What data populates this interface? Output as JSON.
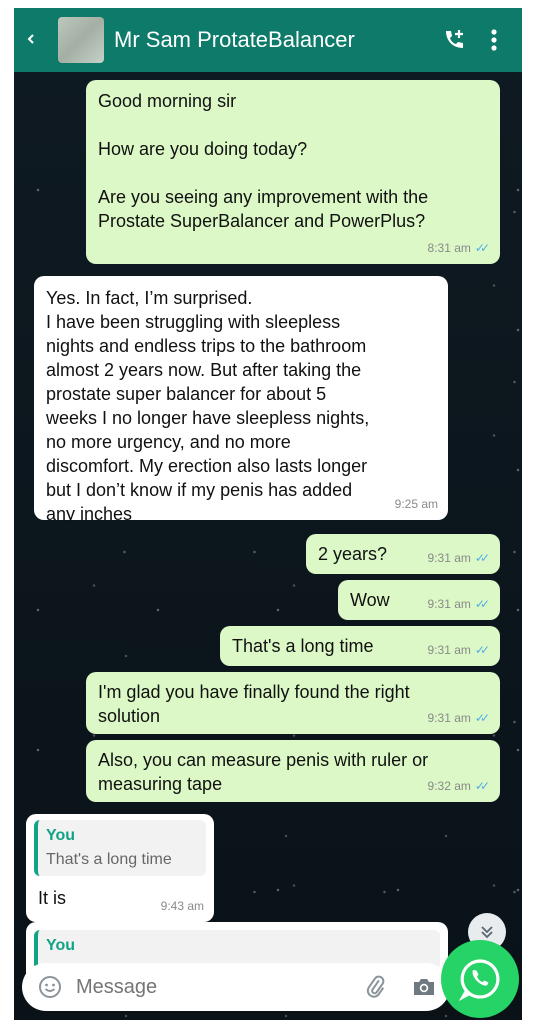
{
  "header": {
    "contact_name": "Mr Sam ProtateBalancer"
  },
  "messages": [
    {
      "dir": "out",
      "text": "Good morning sir\n\nHow are you doing today?\n\nAre you seeing any improvement with the Prostate SuperBalancer and PowerPlus?",
      "time": "8:31 am"
    },
    {
      "dir": "in",
      "text": "Yes. In fact, I’m surprised.\nI have been struggling with sleepless nights and endless trips to the bathroom almost 2 years now. But after taking the prostate super balancer for about 5 weeks I no longer have sleepless nights, no more urgency, and no more discomfort. My erection also lasts longer but I don’t know if my penis has added any inches",
      "time": "9:25 am"
    },
    {
      "dir": "out",
      "text": "2 years?",
      "time": "9:31 am"
    },
    {
      "dir": "out",
      "text": "Wow",
      "time": "9:31 am"
    },
    {
      "dir": "out",
      "text": "That's a long time",
      "time": "9:31 am"
    },
    {
      "dir": "out",
      "text": "I'm glad you have finally found the right solution",
      "time": "9:31 am"
    },
    {
      "dir": "out",
      "text": "Also, you can measure penis with ruler or measuring tape",
      "time": "9:32 am"
    },
    {
      "dir": "in",
      "quote_name": "You",
      "quote_text": "That's a long time",
      "text": "It is",
      "time": "9:43 am"
    },
    {
      "dir": "in",
      "quote_name": "You"
    }
  ],
  "input": {
    "placeholder": "Message"
  },
  "colors": {
    "header": "#0d7a6a",
    "outgoing_bubble": "#dcf8c6",
    "incoming_bubble": "#ffffff",
    "fab": "#25d366",
    "read_ticks": "#4fb0e6"
  },
  "icons": [
    "back-icon",
    "add-call-icon",
    "more-vert-icon",
    "emoji-icon",
    "attach-icon",
    "camera-icon",
    "whatsapp-icon",
    "scroll-down-icon"
  ]
}
